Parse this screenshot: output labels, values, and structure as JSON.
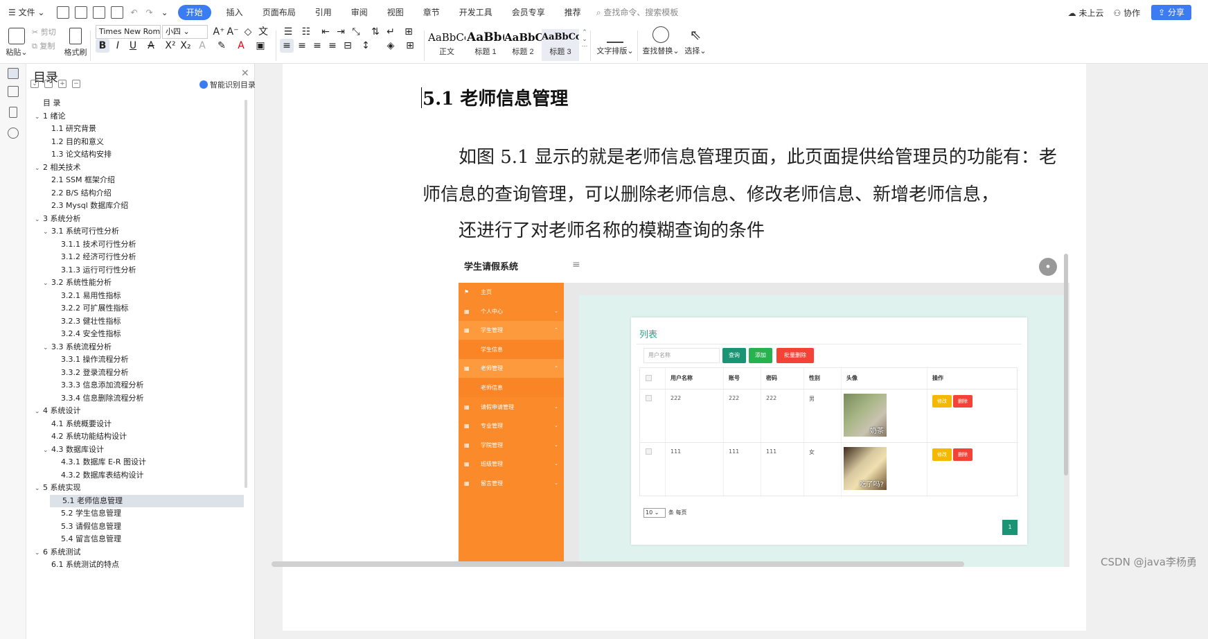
{
  "menubar": {
    "file": "文件",
    "tabs": [
      "开始",
      "插入",
      "页面布局",
      "引用",
      "审阅",
      "视图",
      "章节",
      "开发工具",
      "会员专享",
      "推荐"
    ],
    "search_placeholder": "查找命令、搜索模板",
    "cloud": "未上云",
    "collab": "协作",
    "share": "分享"
  },
  "ribbon": {
    "paste": "粘贴",
    "cut": "剪切",
    "copy": "复制",
    "format_painter": "格式刷",
    "font_name": "Times New Roma",
    "font_size": "小四",
    "styles": [
      {
        "sample": "AaBbCcI",
        "name": "正文"
      },
      {
        "sample": "AaBb(",
        "name": "标题 1"
      },
      {
        "sample": "AaBbC",
        "name": "标题 2"
      },
      {
        "sample": "AaBbCcl",
        "name": "标题 3"
      }
    ],
    "text_layout": "文字排版",
    "find_replace": "查找替换",
    "select": "选择"
  },
  "toc": {
    "title": "目录",
    "smart": "智能识别目录",
    "items": [
      {
        "text": "目 录",
        "level": 0,
        "caret": false
      },
      {
        "text": "1  绪论",
        "level": 0,
        "caret": true
      },
      {
        "text": "1.1  研究背景",
        "level": 1,
        "caret": false
      },
      {
        "text": "1.2  目的和意义",
        "level": 1,
        "caret": false
      },
      {
        "text": "1.3  论文结构安排",
        "level": 1,
        "caret": false
      },
      {
        "text": "2  相关技术",
        "level": 0,
        "caret": true
      },
      {
        "text": "2.1 SSM 框架介绍",
        "level": 1,
        "caret": false
      },
      {
        "text": "2.2 B/S 结构介绍",
        "level": 1,
        "caret": false
      },
      {
        "text": "2.3 Mysql 数据库介绍",
        "level": 1,
        "caret": false
      },
      {
        "text": "3  系统分析",
        "level": 0,
        "caret": true
      },
      {
        "text": "3.1  系统可行性分析",
        "level": 1,
        "caret": true
      },
      {
        "text": "3.1.1  技术可行性分析",
        "level": 2,
        "caret": false
      },
      {
        "text": "3.1.2  经济可行性分析",
        "level": 2,
        "caret": false
      },
      {
        "text": "3.1.3  运行可行性分析",
        "level": 2,
        "caret": false
      },
      {
        "text": "3.2  系统性能分析",
        "level": 1,
        "caret": true
      },
      {
        "text": "3.2.1  易用性指标",
        "level": 2,
        "caret": false
      },
      {
        "text": "3.2.2  可扩展性指标",
        "level": 2,
        "caret": false
      },
      {
        "text": "3.2.3  健壮性指标",
        "level": 2,
        "caret": false
      },
      {
        "text": "3.2.4  安全性指标",
        "level": 2,
        "caret": false
      },
      {
        "text": "3.3  系统流程分析",
        "level": 1,
        "caret": true
      },
      {
        "text": "3.3.1  操作流程分析",
        "level": 2,
        "caret": false
      },
      {
        "text": "3.3.2  登录流程分析",
        "level": 2,
        "caret": false
      },
      {
        "text": "3.3.3  信息添加流程分析",
        "level": 2,
        "caret": false
      },
      {
        "text": "3.3.4  信息删除流程分析",
        "level": 2,
        "caret": false
      },
      {
        "text": "4  系统设计",
        "level": 0,
        "caret": true
      },
      {
        "text": "4.1  系统概要设计",
        "level": 1,
        "caret": false
      },
      {
        "text": "4.2  系统功能结构设计",
        "level": 1,
        "caret": false
      },
      {
        "text": "4.3  数据库设计",
        "level": 1,
        "caret": true
      },
      {
        "text": "4.3.1  数据库 E-R 图设计",
        "level": 2,
        "caret": false
      },
      {
        "text": "4.3.2  数据库表结构设计",
        "level": 2,
        "caret": false
      },
      {
        "text": "5  系统实现",
        "level": 0,
        "caret": true
      },
      {
        "text": "5.1 老师信息管理",
        "level": 2,
        "caret": false,
        "selected": true
      },
      {
        "text": "5.2  学生信息管理",
        "level": 2,
        "caret": false
      },
      {
        "text": "5.3 请假信息管理",
        "level": 2,
        "caret": false
      },
      {
        "text": "5.4 留言信息管理",
        "level": 2,
        "caret": false
      },
      {
        "text": "6  系统测试",
        "level": 0,
        "caret": true
      },
      {
        "text": "6.1  系统测试的特点",
        "level": 1,
        "caret": false
      }
    ]
  },
  "doc": {
    "heading": "5.1 老师信息管理",
    "para1": "如图 5.1 显示的就是老师信息管理页面，此页面提供给管理员的功能有：老",
    "para2": "师信息的查询管理，可以删除老师信息、修改老师信息、新增老师信息，",
    "para3": "还进行了对老师名称的模糊查询的条件"
  },
  "shot": {
    "title": "学生请假系统",
    "menu_icon": "≡",
    "side": [
      {
        "label": "主页",
        "icon": "flag-icon",
        "style": "main"
      },
      {
        "label": "个人中心",
        "icon": "grid-icon",
        "style": "main",
        "arrow": "⌄"
      },
      {
        "label": "学生管理",
        "icon": "grid-icon",
        "style": "sub",
        "arrow": "⌃"
      },
      {
        "label": "学生信息",
        "icon": "",
        "style": "sub2"
      },
      {
        "label": "老师管理",
        "icon": "grid-icon",
        "style": "sub",
        "arrow": "⌃"
      },
      {
        "label": "老师信息",
        "icon": "",
        "style": "sub2"
      },
      {
        "label": "请假申请管理",
        "icon": "grid-icon",
        "style": "main",
        "arrow": "⌄"
      },
      {
        "label": "专业管理",
        "icon": "grid-icon",
        "style": "main",
        "arrow": "⌄"
      },
      {
        "label": "学院管理",
        "icon": "grid-icon",
        "style": "main",
        "arrow": "⌄"
      },
      {
        "label": "班级管理",
        "icon": "grid-icon",
        "style": "main",
        "arrow": "⌄"
      },
      {
        "label": "留言管理",
        "icon": "grid-icon",
        "style": "main",
        "arrow": "⌄"
      }
    ],
    "card_title": "列表",
    "search_placeholder": "用户名称",
    "btn_query": "查询",
    "btn_add": "添加",
    "btn_batch_delete": "批量删除",
    "columns": [
      "用户名称",
      "账号",
      "密码",
      "性别",
      "头像",
      "操作"
    ],
    "rows": [
      {
        "name": "222",
        "account": "222",
        "password": "222",
        "gender": "男",
        "caption": "奶茶"
      },
      {
        "name": "111",
        "account": "111",
        "password": "111",
        "gender": "女",
        "caption": "吃了吗?"
      }
    ],
    "edit": "修改",
    "delete": "删除",
    "page_size": "10",
    "page_size_label": "条 每页",
    "page_number": "1"
  },
  "watermark": "CSDN @java李杨勇"
}
